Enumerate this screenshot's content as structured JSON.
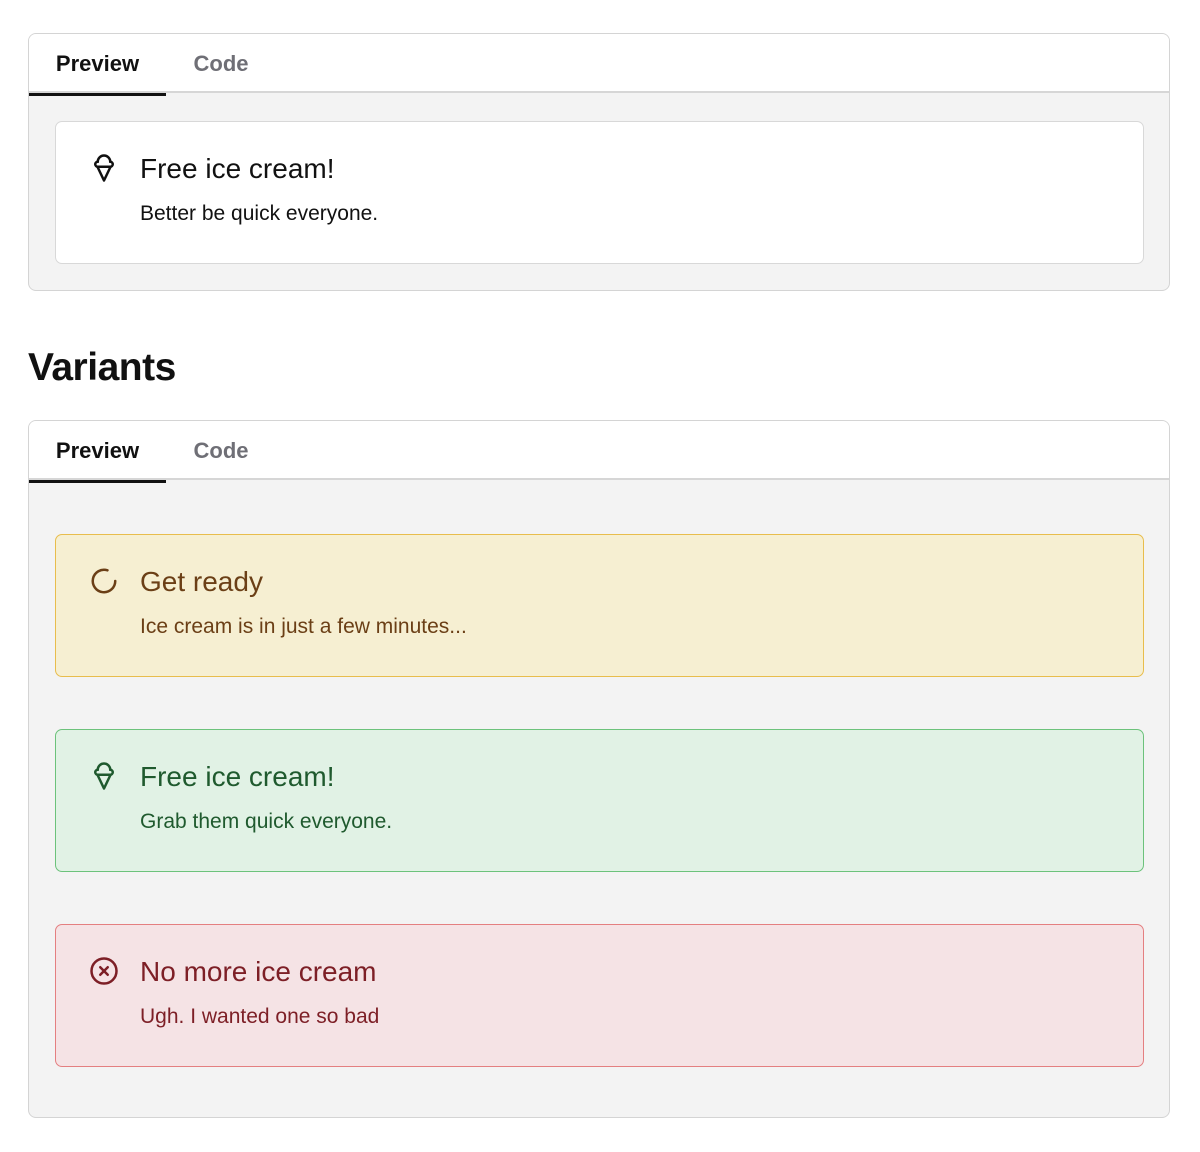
{
  "demo": {
    "tabs": {
      "preview": "Preview",
      "code": "Code"
    },
    "alert": {
      "icon": "ice-cream-icon",
      "title": "Free ice cream!",
      "description": "Better be quick everyone."
    }
  },
  "variants": {
    "heading": "Variants",
    "tabs": {
      "preview": "Preview",
      "code": "Code"
    },
    "alerts": [
      {
        "variant": "warning",
        "icon": "loader-circle-icon",
        "title": "Get ready",
        "description": "Ice cream is in just a few minutes...",
        "colors": {
          "background": "#f6efd2",
          "border": "#e8bd4c",
          "text": "#6b3f16"
        }
      },
      {
        "variant": "success",
        "icon": "ice-cream-icon",
        "title": "Free ice cream!",
        "description": "Grab them quick everyone.",
        "colors": {
          "background": "#e1f2e5",
          "border": "#6cc27b",
          "text": "#1f5a2e"
        }
      },
      {
        "variant": "danger",
        "icon": "circle-x-icon",
        "title": "No more ice cream",
        "description": "Ugh. I wanted one so bad",
        "colors": {
          "background": "#f5e3e5",
          "border": "#e47f80",
          "text": "#7d1f26"
        }
      }
    ]
  }
}
